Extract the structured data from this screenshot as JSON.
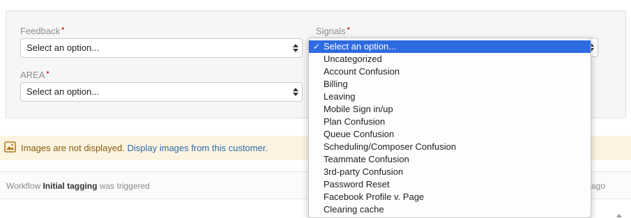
{
  "form": {
    "feedback_label": "Feedback",
    "feedback_value": "Select an option...",
    "area_label": "AREA",
    "area_value": "Select an option...",
    "signals_label": "Signals",
    "required_marker": "•"
  },
  "signals_dropdown": {
    "check_mark": "✓",
    "options": [
      "Select an option...",
      "Uncategorized",
      "Account Confusion",
      "Billing",
      "Leaving",
      "Mobile Sign in/up",
      "Plan Confusion",
      "Queue Confusion",
      "Scheduling/Composer Confusion",
      "Teammate Confusion",
      "3rd-party Confusion",
      "Password Reset",
      "Facebook Profile v. Page",
      "Clearing cache"
    ],
    "selected_index": 0
  },
  "banner": {
    "message": "Images are not displayed.",
    "link": "Display images from this customer.",
    "icon": "image-icon"
  },
  "activity": {
    "prefix": "Workflow",
    "workflow_name": "Initial tagging",
    "suffix": "was triggered",
    "time": "ago"
  },
  "colors": {
    "accent": "#2f6be0",
    "required": "#e03131",
    "banner_bg": "#fcf4e1",
    "link": "#2d6aa8"
  }
}
